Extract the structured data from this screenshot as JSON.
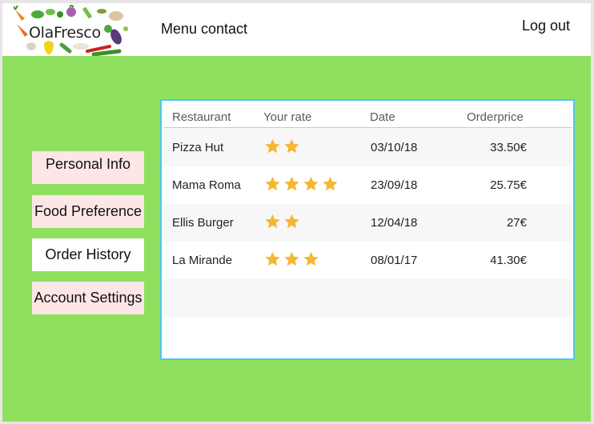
{
  "header": {
    "logo_text": "OlaFresco",
    "menu_link": "Menu contact",
    "logout_link": "Log out"
  },
  "sidebar": {
    "items": [
      {
        "label": "Personal Info"
      },
      {
        "label": "Food Preference"
      },
      {
        "label": "Order History"
      },
      {
        "label": "Account Settings"
      }
    ]
  },
  "orders": {
    "columns": [
      "Restaurant",
      "Your rate",
      "Date",
      "Orderprice"
    ],
    "rows": [
      {
        "restaurant": "Pizza Hut",
        "rating": 2,
        "date": "03/10/18",
        "price": "33.50€"
      },
      {
        "restaurant": "Mama Roma",
        "rating": 4,
        "date": "23/09/18",
        "price": "25.75€"
      },
      {
        "restaurant": "Ellis Burger",
        "rating": 2,
        "date": "12/04/18",
        "price": "27€"
      },
      {
        "restaurant": "La Mirande",
        "rating": 3,
        "date": "08/01/17",
        "price": "41.30€"
      }
    ]
  },
  "colors": {
    "page_background": "#90e060",
    "panel_border": "#4cc8e8",
    "star": "#f5b731",
    "sidebar_highlight": "#fde6e6"
  }
}
